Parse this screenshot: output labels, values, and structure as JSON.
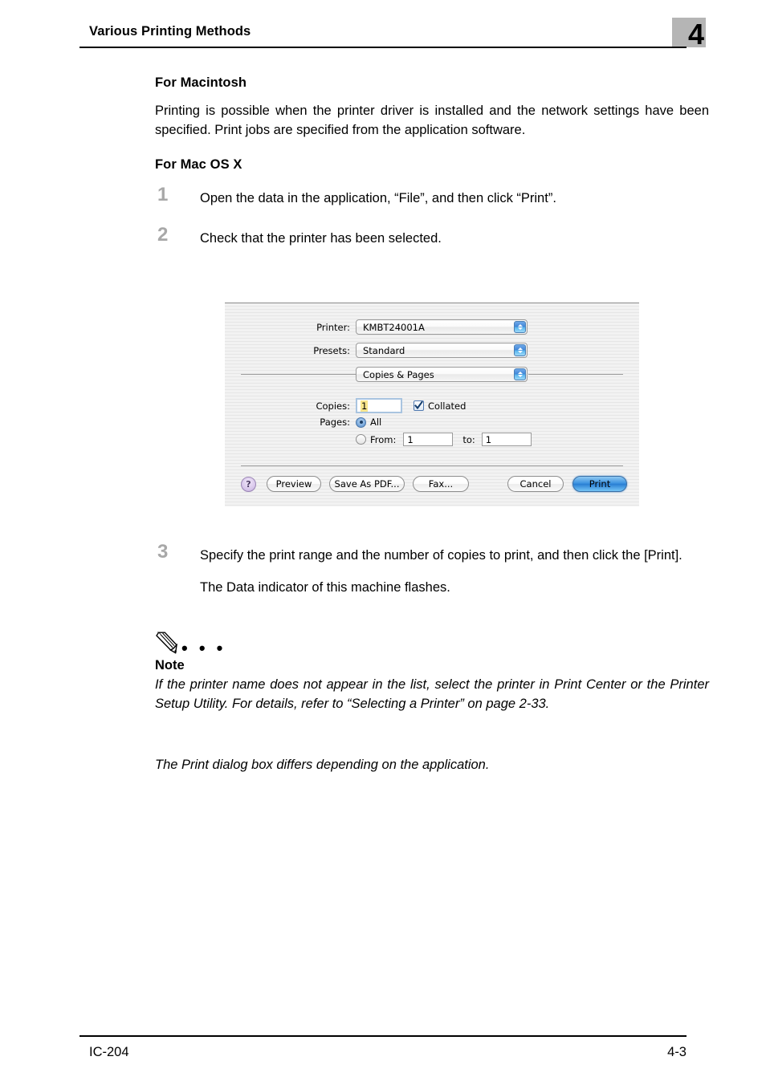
{
  "header": {
    "title": "Various Printing Methods",
    "chapter_number": "4"
  },
  "sections": {
    "macintosh_heading": "For Macintosh",
    "macintosh_paragraph": "Printing is possible when the printer driver is installed and the network settings have been specified. Print jobs are specified from the application software.",
    "macosx_heading": "For Mac OS X"
  },
  "steps": [
    {
      "number": "1",
      "text": "Open the data in the application, “File”, and then click “Print”."
    },
    {
      "number": "2",
      "text": "Check that the printer has been selected."
    },
    {
      "number": "3",
      "text": "Specify the print range and the number of copies to print, and then click the [Print].",
      "sub": "The Data indicator of this machine flashes."
    }
  ],
  "print_dialog": {
    "printer_label": "Printer:",
    "printer_value": "KMBT24001A",
    "presets_label": "Presets:",
    "presets_value": "Standard",
    "pane_value": "Copies & Pages",
    "copies_label": "Copies:",
    "copies_value": "1",
    "collated_label": "Collated",
    "collated_checked": true,
    "pages_label": "Pages:",
    "pages_all_label": "All",
    "pages_all_selected": true,
    "pages_from_label": "From:",
    "pages_from_value": "1",
    "pages_to_label": "to:",
    "pages_to_value": "1",
    "help_label": "?",
    "preview_label": "Preview",
    "save_pdf_label": "Save As PDF...",
    "fax_label": "Fax...",
    "cancel_label": "Cancel",
    "print_label": "Print",
    "accent_color": "#3d93e0",
    "background_color": "#ededed"
  },
  "note": {
    "dots": "• • •",
    "title": "Note",
    "body": "If the printer name does not appear in the list, select the printer in Print Center or the Printer Setup Utility. For details, refer to “Selecting a Printer” on page 2-33.",
    "extra": "The Print dialog box differs depending on the application."
  },
  "footer": {
    "left": "IC-204",
    "right": "4-3"
  }
}
